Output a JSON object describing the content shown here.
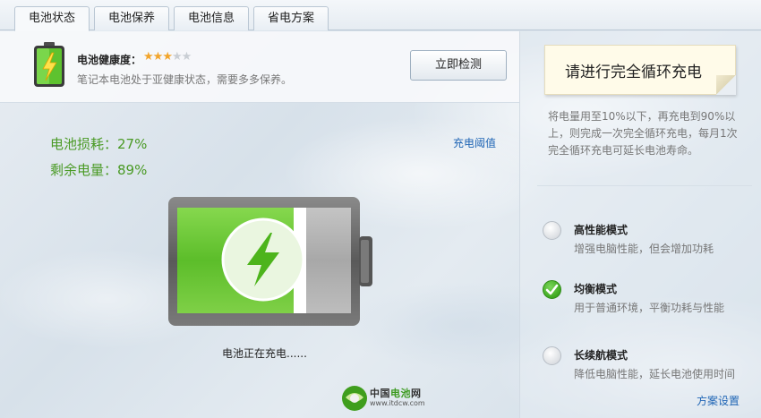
{
  "tabs": [
    {
      "label": "电池状态",
      "active": true
    },
    {
      "label": "电池保养",
      "active": false
    },
    {
      "label": "电池信息",
      "active": false
    },
    {
      "label": "省电方案",
      "active": false
    }
  ],
  "health": {
    "title": "电池健康度：",
    "rating": 3,
    "rating_max": 5,
    "description": "笔记本电池处于亚健康状态，需要多多保养。",
    "detect_button": "立即检测"
  },
  "stats": {
    "loss_label": "电池损耗：27%",
    "remain_label": "剩余电量：89%",
    "charge_level": 0.89
  },
  "threshold_link": "充电阈值",
  "charging_status": "电池正在充电......",
  "logo": {
    "name_prefix": "中国",
    "name_highlight": "电池",
    "name_suffix": "网",
    "url": "www.itdcw.com"
  },
  "tip": {
    "title": "请进行完全循环充电",
    "description": "将电量用至10%以下，再充电到90%以上，则完成一次完全循环充电，每月1次完全循环充电可延长电池寿命。"
  },
  "modes": [
    {
      "name": "高性能模式",
      "description": "增强电脑性能，但会增加功耗",
      "selected": false
    },
    {
      "name": "均衡模式",
      "description": "用于普通环境，平衡功耗与性能",
      "selected": true
    },
    {
      "name": "长续航模式",
      "description": "降低电脑性能，延长电池使用时间",
      "selected": false
    }
  ],
  "plan_settings_link": "方案设置",
  "colors": {
    "accent_green": "#4a9a25",
    "link_blue": "#1f65b5",
    "star_gold": "#f2a52b"
  }
}
